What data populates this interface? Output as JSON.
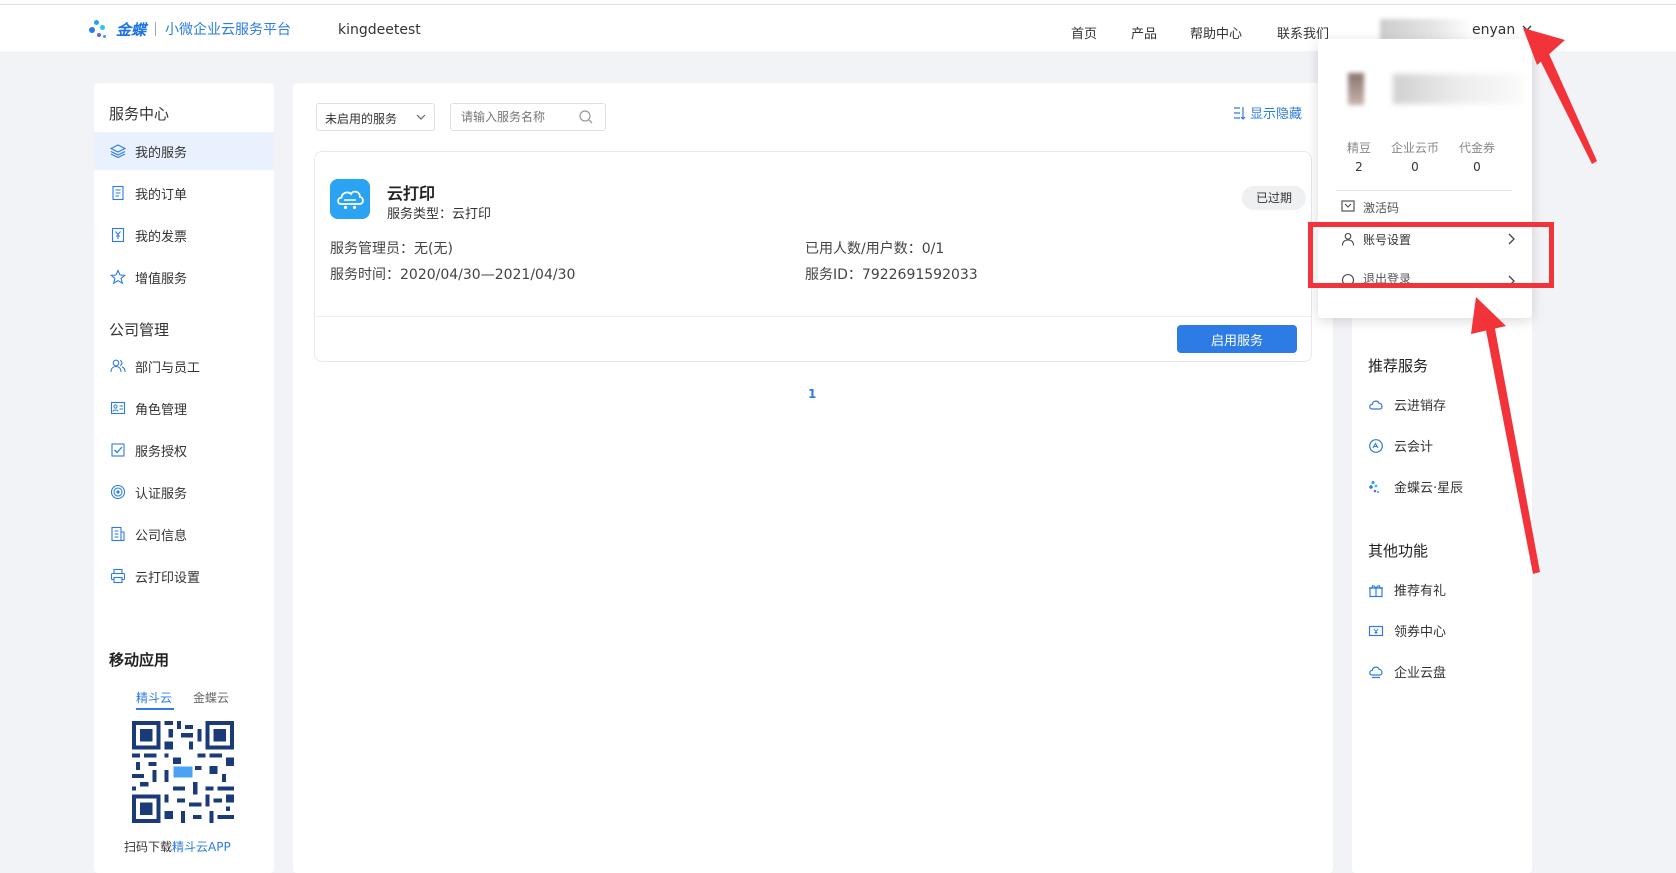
{
  "header": {
    "brand": "金蝶",
    "platform": "小微企业云服务平台",
    "company": "kingdeetest",
    "nav": [
      "首页",
      "产品",
      "帮助中心",
      "联系我们"
    ],
    "user_name": "enyan"
  },
  "sidebar": {
    "service_center_title": "服务中心",
    "service_items": [
      {
        "label": "我的服务",
        "icon": "layers-icon",
        "active": true
      },
      {
        "label": "我的订单",
        "icon": "order-icon"
      },
      {
        "label": "我的发票",
        "icon": "invoice-icon"
      },
      {
        "label": "增值服务",
        "icon": "star-icon"
      }
    ],
    "company_title": "公司管理",
    "company_items": [
      {
        "label": "部门与员工",
        "icon": "users-icon"
      },
      {
        "label": "角色管理",
        "icon": "role-icon"
      },
      {
        "label": "服务授权",
        "icon": "authorize-icon"
      },
      {
        "label": "认证服务",
        "icon": "certify-icon"
      },
      {
        "label": "公司信息",
        "icon": "company-info-icon"
      },
      {
        "label": "云打印设置",
        "icon": "printer-icon"
      }
    ],
    "mobile_title": "移动应用",
    "mobile_tabs": [
      "精斗云",
      "金蝶云"
    ],
    "scan_prefix": "扫码下载",
    "scan_app": "精斗云APP"
  },
  "main": {
    "filter_select": "未启用的服务",
    "search_placeholder": "请输入服务名称",
    "toggle_label": "显示隐藏",
    "card": {
      "name": "云打印",
      "type_label": "服务类型：云打印",
      "status_badge": "已过期",
      "admin": "服务管理员：无(无)",
      "service_time": "服务时间：2020/04/30—2021/04/30",
      "users": "已用人数/用户数：0/1",
      "service_id": "服务ID：7922691592033",
      "enable_button": "启用服务"
    },
    "page": "1"
  },
  "dropdown": {
    "stats": [
      {
        "label": "精豆",
        "value": "2"
      },
      {
        "label": "企业云币",
        "value": "0"
      },
      {
        "label": "代金券",
        "value": "0"
      }
    ],
    "items": [
      "激活码",
      "账号设置",
      "退出登录"
    ]
  },
  "right_panel": {
    "recommend_title": "推荐服务",
    "recommend_items": [
      {
        "label": "云进销存",
        "icon": "cloud-icon"
      },
      {
        "label": "云会计",
        "icon": "accounting-icon"
      },
      {
        "label": "金蝶云·星辰",
        "icon": "kingdee-icon"
      }
    ],
    "other_title": "其他功能",
    "other_items": [
      {
        "label": "推荐有礼",
        "icon": "gift-icon"
      },
      {
        "label": "领券中心",
        "icon": "coupon-icon"
      },
      {
        "label": "企业云盘",
        "icon": "cloud-disk-icon"
      }
    ]
  },
  "colors": {
    "accent": "#2d7be5",
    "annotation": "#f2333a",
    "background": "#f2f3f7"
  }
}
